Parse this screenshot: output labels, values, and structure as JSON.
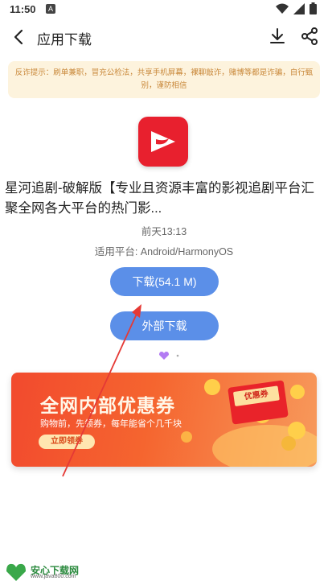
{
  "status_bar": {
    "time": "11:50",
    "notif_letter": "A"
  },
  "app_bar": {
    "title": "应用下载"
  },
  "notice": {
    "text": "反诈提示：刷单兼职，冒充公检法，共享手机屏幕，裸聊敲诈，赌博等都是诈骗，自行甄别，谨防相信"
  },
  "app": {
    "name": "星河追剧-破解版【专业且资源丰富的影视追剧平台汇聚全网各大平台的热门影...",
    "date": "前天13:13",
    "platform": "适用平台: Android/HarmonyOS"
  },
  "buttons": {
    "download": "下载(54.1 M)",
    "external": "外部下载"
  },
  "banner": {
    "title": "全网内部优惠券",
    "subtitle": "购物前，先领券，每年能省个几千块",
    "cta": "立即领券",
    "coupon_label": "优惠券"
  },
  "watermark": {
    "name": "安心下载网",
    "url": "www.java800.com"
  },
  "colors": {
    "accent": "#5b8fe8",
    "notice_bg": "#fdf3dd",
    "notice_text": "#c9883a",
    "brand_red": "#e8202e"
  }
}
